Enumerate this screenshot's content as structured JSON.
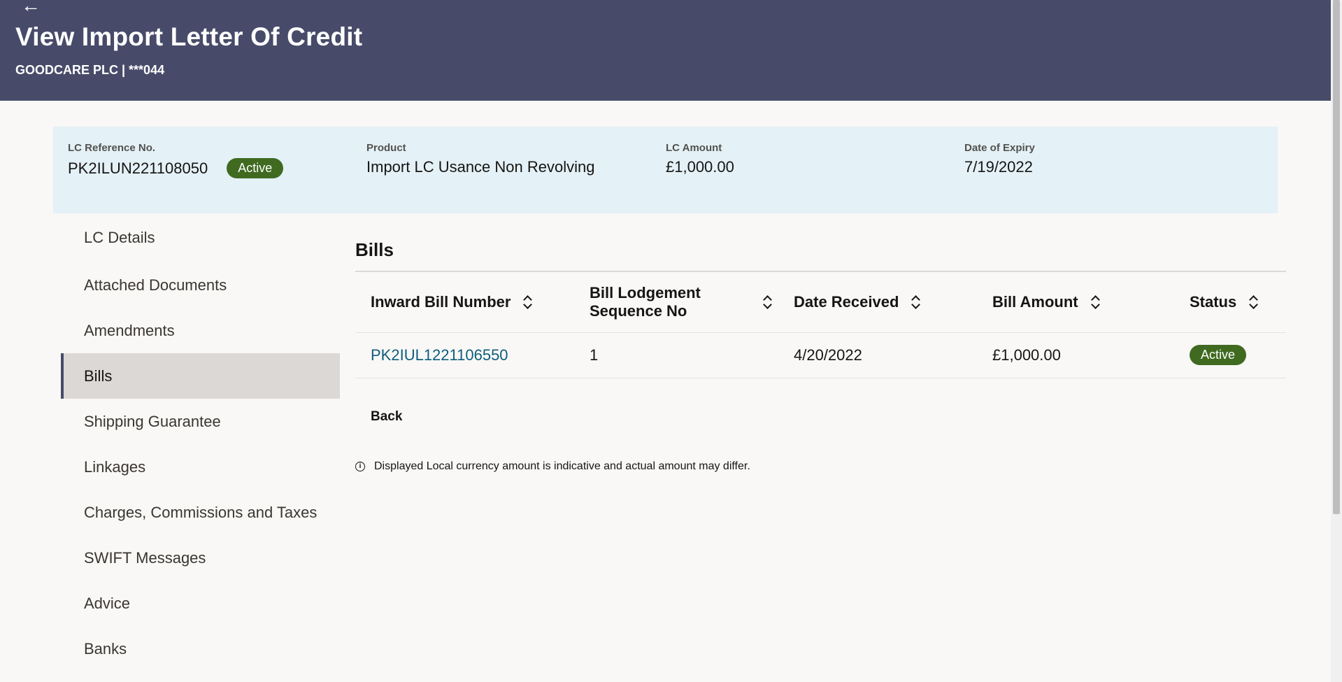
{
  "header": {
    "back_icon": "arrow-left-icon",
    "title": "View Import Letter Of Credit",
    "subtitle": "GOODCARE PLC | ***044"
  },
  "summary": {
    "reference_label": "LC Reference No.",
    "reference_value": "PK2ILUN221108050",
    "reference_status": "Active",
    "product_label": "Product",
    "product_value": "Import LC Usance Non Revolving",
    "amount_label": "LC Amount",
    "amount_value": "£1,000.00",
    "expiry_label": "Date of Expiry",
    "expiry_value": "7/19/2022"
  },
  "sidebar": {
    "items": [
      {
        "label": "LC Details"
      },
      {
        "label": "Attached Documents"
      },
      {
        "label": "Amendments"
      },
      {
        "label": "Bills"
      },
      {
        "label": "Shipping Guarantee"
      },
      {
        "label": "Linkages"
      },
      {
        "label": "Charges, Commissions and Taxes"
      },
      {
        "label": "SWIFT Messages"
      },
      {
        "label": "Advice"
      },
      {
        "label": "Banks"
      }
    ],
    "active": "Bills"
  },
  "bills": {
    "title": "Bills",
    "columns": [
      "Inward Bill Number",
      "Bill Lodgement Sequence No",
      "Date Received",
      "Bill Amount",
      "Status"
    ],
    "rows": [
      {
        "bill_number": "PK2IUL1221106550",
        "sequence": "1",
        "date_received": "4/20/2022",
        "amount": "£1,000.00",
        "status": "Active"
      }
    ],
    "back_label": "Back",
    "note": "Displayed Local currency amount is indicative and actual amount may differ."
  },
  "colors": {
    "header_bg": "#474b69",
    "summary_bg": "#e4f1f7",
    "status_active": "#3f6a20",
    "link": "#0f5e7d"
  }
}
